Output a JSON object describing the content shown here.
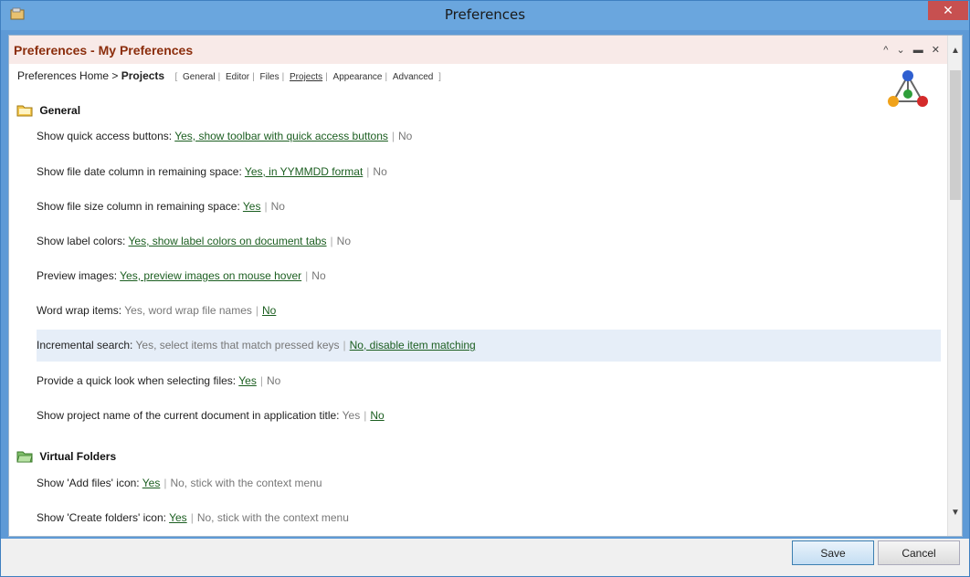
{
  "window": {
    "title": "Preferences",
    "close_label": "✕"
  },
  "header": {
    "title": "Preferences - My Preferences",
    "icons": "^ ⌄ ▬ ✕"
  },
  "breadcrumb": {
    "home": "Preferences Home",
    "separator": ">",
    "current": "Projects",
    "bracket_open": "[",
    "bracket_close": "]",
    "divider": "|",
    "links": [
      "General",
      "Editor",
      "Files",
      "Projects",
      "Appearance",
      "Advanced"
    ]
  },
  "sections": [
    {
      "title": "General",
      "options": [
        {
          "label": "Show quick access buttons:",
          "yes": "Yes, show toolbar with quick access buttons",
          "no": "No",
          "selected": "yes"
        },
        {
          "label": "Show file date column in remaining space:",
          "yes": "Yes, in YYMMDD format",
          "no": "No",
          "selected": "yes"
        },
        {
          "label": "Show file size column in remaining space:",
          "yes": "Yes",
          "no": "No",
          "selected": "yes"
        },
        {
          "label": "Show label colors:",
          "yes": "Yes, show label colors on document tabs",
          "no": "No",
          "selected": "yes"
        },
        {
          "label": "Preview images:",
          "yes": "Yes, preview images on mouse hover",
          "no": "No",
          "selected": "yes"
        },
        {
          "label": "Word wrap items:",
          "yes": "Yes, word wrap file names",
          "no": "No",
          "selected": "no"
        },
        {
          "label": "Incremental search:",
          "yes": "Yes, select items that match pressed keys",
          "no": "No, disable item matching",
          "selected": "no"
        },
        {
          "label": "Provide a quick look when selecting files:",
          "yes": "Yes",
          "no": "No",
          "selected": "yes"
        },
        {
          "label": "Show project name of the current document in application title:",
          "yes": "Yes",
          "no": "No",
          "selected": "no"
        }
      ]
    },
    {
      "title": "Virtual Folders",
      "options": [
        {
          "label": "Show 'Add files' icon:",
          "yes": "Yes",
          "no": "No, stick with the context menu",
          "selected": "yes"
        },
        {
          "label": "Show 'Create folders' icon:",
          "yes": "Yes",
          "no": "No, stick with the context menu",
          "selected": "yes"
        }
      ]
    }
  ],
  "footer": {
    "save_label": "Save",
    "cancel_label": "Cancel"
  },
  "colors": {
    "selected_link": "#1b5e20",
    "header_title": "#8b2d0c",
    "highlight_row": "#e6eef8"
  }
}
